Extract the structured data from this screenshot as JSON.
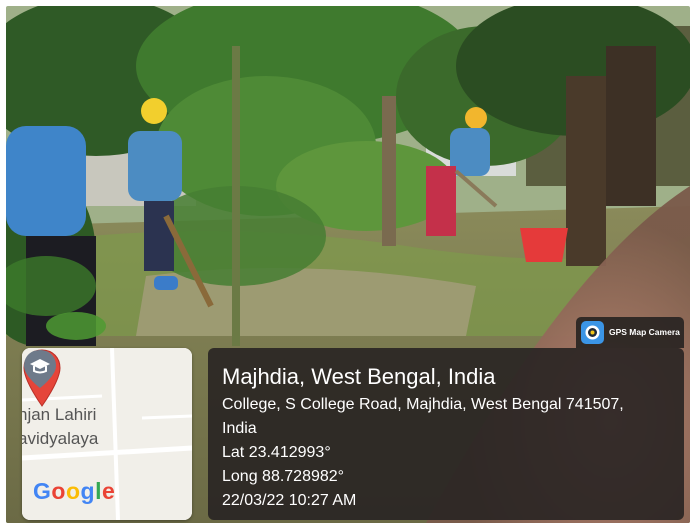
{
  "location": {
    "title": "Majhdia, West Bengal, India",
    "address_line1": "College, S College Road, Majhdia, West Bengal 741507,",
    "address_line2": "India",
    "lat": "Lat 23.412993°",
    "long": "Long 88.728982°",
    "datetime": "22/03/22 10:27 AM"
  },
  "badge": {
    "label": "GPS Map Camera",
    "icon": "gps-camera-app-icon"
  },
  "map": {
    "label_line1": "njan Lahiri",
    "label_line2": "avidyalaya",
    "pin_icon": "map-pin-icon",
    "place_icon": "graduation-cap-icon",
    "logo_text": "Google",
    "colors": {
      "pin": "#e5453a",
      "place_marker": "#6e7a8a",
      "google_blue": "#4285F4",
      "google_red": "#EA4335",
      "google_yellow": "#FBBC05",
      "google_green": "#34A853"
    }
  },
  "colors": {
    "panel_bg": "#282422",
    "panel_text": "#ffffff"
  }
}
